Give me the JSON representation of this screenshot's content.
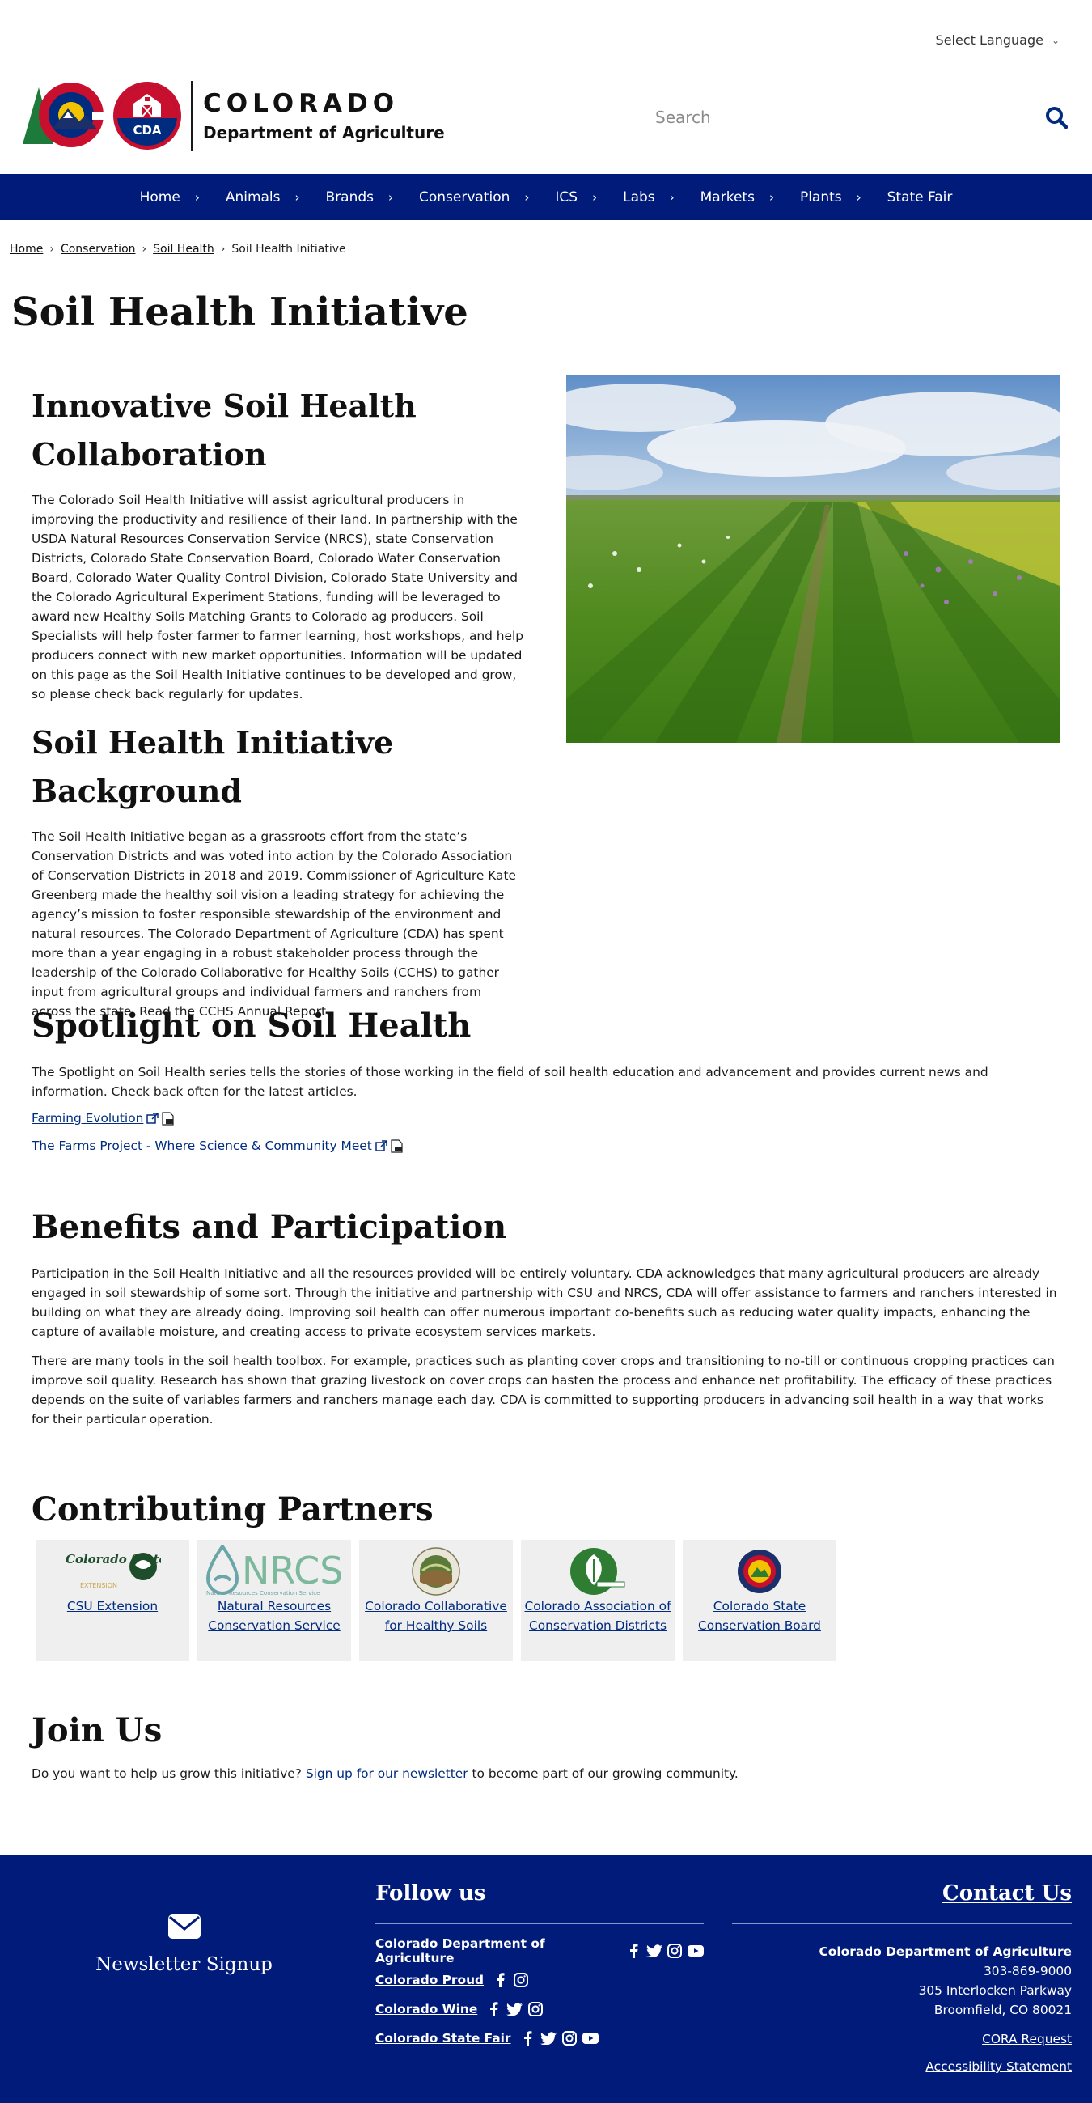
{
  "header": {
    "language_label": "Select Language",
    "logo_word_top": "COLORADO",
    "logo_word_bottom": "Department of Agriculture",
    "logo_badge": "CDA",
    "search_placeholder": "Search"
  },
  "nav": {
    "items": [
      {
        "label": "Home"
      },
      {
        "label": "Animals"
      },
      {
        "label": "Brands"
      },
      {
        "label": "Conservation"
      },
      {
        "label": "ICS"
      },
      {
        "label": "Labs"
      },
      {
        "label": "Markets"
      },
      {
        "label": "Plants"
      },
      {
        "label": "State Fair"
      }
    ]
  },
  "breadcrumb": {
    "home": "Home",
    "conservation": "Conservation",
    "soil_health": "Soil Health",
    "current": "Soil Health Initiative"
  },
  "page_title": "Soil Health Initiative",
  "intro": {
    "heading1": "Innovative Soil Health Collaboration",
    "paragraph1": "The Colorado Soil Health Initiative will assist agricultural producers in improving the productivity and resilience of their land. In partnership with the USDA Natural Resources Conservation Service (NRCS), state Conservation Districts, Colorado State Conservation Board, Colorado Water Conservation Board, Colorado Water Quality Control Division, Colorado State University and the Colorado Agricultural Experiment Stations, funding will be leveraged to award new Healthy Soils Matching Grants to Colorado ag producers. Soil Specialists will help foster farmer to farmer learning, host workshops, and help producers connect with new market opportunities. Information will be updated on this page as the Soil Health Initiative continues to be developed and grow, so please check back regularly for updates.",
    "heading2": "Soil Health Initiative Background",
    "paragraph2": "The Soil Health Initiative began as a grassroots effort from the state’s Conservation Districts and was voted into action by the Colorado Association of Conservation Districts in 2018 and 2019. Commissioner of Agriculture Kate Greenberg made the healthy soil vision a leading strategy for achieving the agency’s mission to foster responsible stewardship of the environment and natural resources. The Colorado Department of Agriculture (CDA) has spent more than a year engaging in a robust stakeholder process through the leadership of the Colorado Collaborative for Healthy Soils (CCHS) to gather input from agricultural groups and individual farmers and ranchers from across the state. Read the CCHS Annual Report."
  },
  "spotlight": {
    "heading": "Spotlight on Soil Health",
    "paragraph": "The Spotlight on Soil Health series tells the stories of those working in the field of soil health education and advancement and provides current news and information. Check back often for the latest articles.",
    "links": [
      {
        "label": "Farming Evolution"
      },
      {
        "label": "The Farms Project - Where Science & Community Meet"
      }
    ]
  },
  "benefits": {
    "heading": "Benefits and Participation",
    "paragraph1": "Participation in the Soil Health Initiative and all the resources provided will be entirely voluntary. CDA acknowledges that many agricultural producers are already engaged in soil stewardship of some sort. Through the initiative and partnership with CSU and NRCS, CDA will offer assistance to farmers and ranchers interested in building on what they are already doing. Improving soil health can offer numerous important co-benefits such as reducing water quality impacts, enhancing the capture of available moisture, and creating access to private ecosystem services markets.",
    "paragraph2": "There are many tools in the soil health toolbox. For example, practices such as planting cover crops and transitioning to no-till or continuous cropping practices can improve soil quality. Research has shown that grazing livestock on cover crops can hasten the process and enhance net profitability. The efficacy of these practices depends on the suite of variables farmers and ranchers manage each day. CDA is committed to supporting producers in advancing soil health in a way that works for their particular operation."
  },
  "partners": {
    "heading": "Contributing Partners",
    "csu_logo_text": "Colorado State",
    "csu_logo_sub": "EXTENSION",
    "nrcs_logo_text": "NRCS",
    "nrcs_logo_sub": "Natural Resources Conservation Service",
    "items": [
      {
        "label": "CSU Extension"
      },
      {
        "label": "Natural Resources Conservation Service"
      },
      {
        "label": "Colorado Collaborative for Healthy Soils"
      },
      {
        "label": "Colorado Association of Conservation Districts"
      },
      {
        "label": "Colorado State Conservation Board"
      }
    ]
  },
  "join": {
    "heading": "Join Us",
    "text_before": "Do you want to help us grow this initiative? ",
    "link": "Sign up for our newsletter",
    "text_after": " to become part of our growing community."
  },
  "footer": {
    "newsletter_label": "Newsletter Signup",
    "follow_heading": "Follow us",
    "follow_rows": [
      {
        "label": "Colorado Department of Agriculture"
      },
      {
        "label": "Colorado Proud"
      },
      {
        "label": "Colorado Wine"
      },
      {
        "label": "Colorado State Fair"
      }
    ],
    "contact_heading": "Contact Us",
    "contact_org": "Colorado Department of Agriculture",
    "contact_phone": "303-869-9000",
    "contact_address1": "305 Interlocken Parkway",
    "contact_address2": "Broomfield, CO 80021",
    "cora_link": "CORA Request",
    "accessibility_link": "Accessibility Statement"
  },
  "colors": {
    "nav_blue": "#001b7a",
    "link_blue": "#002b7f",
    "brand_red": "#c8102e",
    "brand_yellow": "#f2c300",
    "partner_card_bg": "#efefef"
  }
}
